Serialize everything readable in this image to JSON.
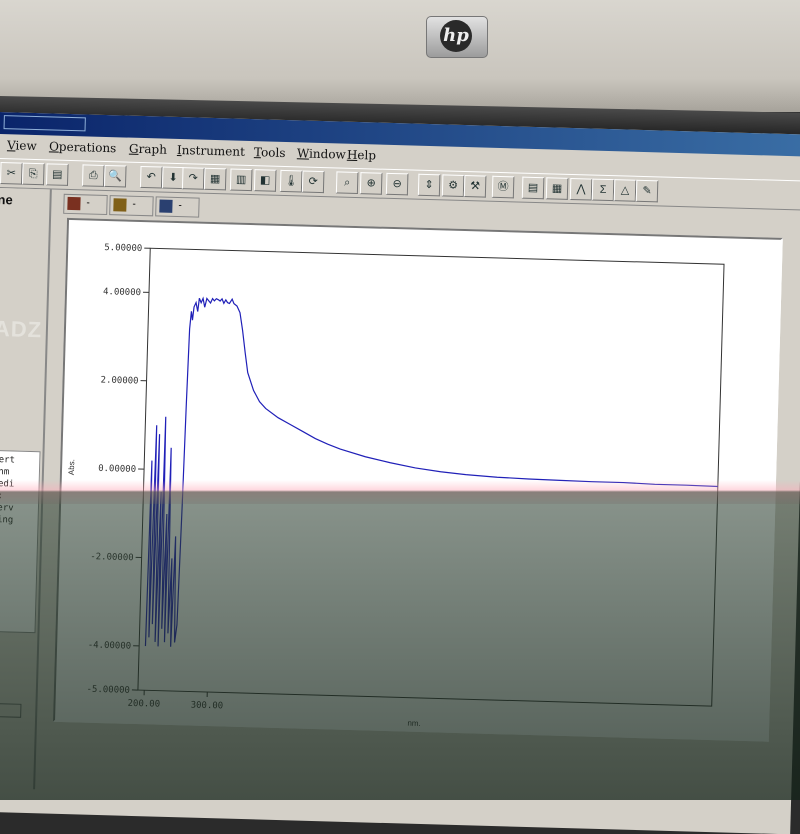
{
  "bezel": {
    "brand": "hp"
  },
  "menus": [
    "View",
    "Operations",
    "Graph",
    "Instrument",
    "Tools",
    "Window",
    "Help"
  ],
  "left_panel": {
    "title": "ne",
    "watermark": "ADZ",
    "lines": [
      "pert",
      "(nm",
      "Medi",
      "1:",
      "terv",
      "Sing"
    ]
  },
  "tabs": [
    {
      "icon": "spectrum-icon",
      "label": "-",
      "color": "#7a3020"
    },
    {
      "icon": "peak-icon",
      "label": "-",
      "color": "#806018"
    },
    {
      "icon": "table-icon",
      "label": "-",
      "color": "#2a4070"
    }
  ],
  "toolbar_icons": [
    "cut-icon",
    "copy-icon",
    "paste-icon",
    "print-icon",
    "print-preview-icon",
    "undo-icon",
    "download-icon",
    "redo-icon",
    "load-icon",
    "sample-icon",
    "color-icon",
    "thermometer-icon",
    "scan-icon",
    "zoom-icon",
    "zoom-in-icon",
    "zoom-out-icon",
    "scale-icon",
    "tools-icon",
    "settings-icon",
    "measure-icon",
    "report-icon",
    "calc-icon",
    "peak-icon",
    "formula-icon",
    "triangle-icon",
    "pen-icon"
  ],
  "colors": {
    "trace": "#2020b8",
    "axis": "#333333",
    "screen": "#d4d0c8",
    "plot_bg": "#ffffff"
  },
  "chart_data": {
    "type": "line",
    "xlabel": "nm.",
    "ylabel": "Abs.",
    "xlim": [
      190,
      1100
    ],
    "ylim": [
      -5,
      5
    ],
    "x_ticks": [
      "200.00",
      "300.00"
    ],
    "y_ticks": [
      "5.00000",
      "4.00000",
      "2.00000",
      "0.00000",
      "-2.00000",
      "-4.00000",
      "-5.00000"
    ],
    "series": [
      {
        "x": [
          200,
          202,
          205,
          208,
          210,
          213,
          215,
          218,
          220,
          222,
          225,
          228,
          230,
          232,
          235,
          238,
          240,
          243,
          246,
          249,
          252,
          254,
          256,
          258,
          260,
          262,
          265,
          268,
          270,
          273,
          276,
          279,
          282,
          285,
          288,
          291,
          294,
          297,
          300,
          303,
          306,
          309,
          312,
          315,
          318,
          320,
          322,
          325,
          330,
          335,
          340,
          345,
          350,
          360,
          370,
          380,
          400,
          420,
          440,
          460,
          480,
          500,
          540,
          580,
          620,
          660,
          700,
          750,
          800,
          850,
          900,
          950,
          1000,
          1050,
          1100
        ],
        "y": [
          -4,
          0.2,
          -3.8,
          1.0,
          -3.5,
          0.8,
          -3.9,
          -0.5,
          -4.0,
          1.2,
          -3.6,
          -1.0,
          -3.9,
          0.5,
          -3.7,
          -2.0,
          -4.0,
          -1.5,
          -3.9,
          -3.5,
          -0.8,
          1.5,
          3.2,
          3.6,
          3.4,
          3.7,
          3.8,
          3.6,
          3.9,
          3.8,
          3.9,
          3.7,
          3.9,
          3.85,
          3.8,
          3.9,
          3.85,
          3.9,
          3.88,
          3.85,
          3.9,
          3.8,
          3.88,
          3.82,
          3.8,
          3.85,
          3.9,
          3.8,
          3.75,
          3.6,
          3.2,
          2.7,
          2.25,
          1.85,
          1.6,
          1.45,
          1.25,
          1.1,
          0.95,
          0.8,
          0.68,
          0.58,
          0.42,
          0.3,
          0.2,
          0.13,
          0.08,
          0.04,
          0.02,
          0.01,
          0.0,
          0.0,
          -0.02,
          -0.02,
          -0.03
        ]
      }
    ]
  }
}
